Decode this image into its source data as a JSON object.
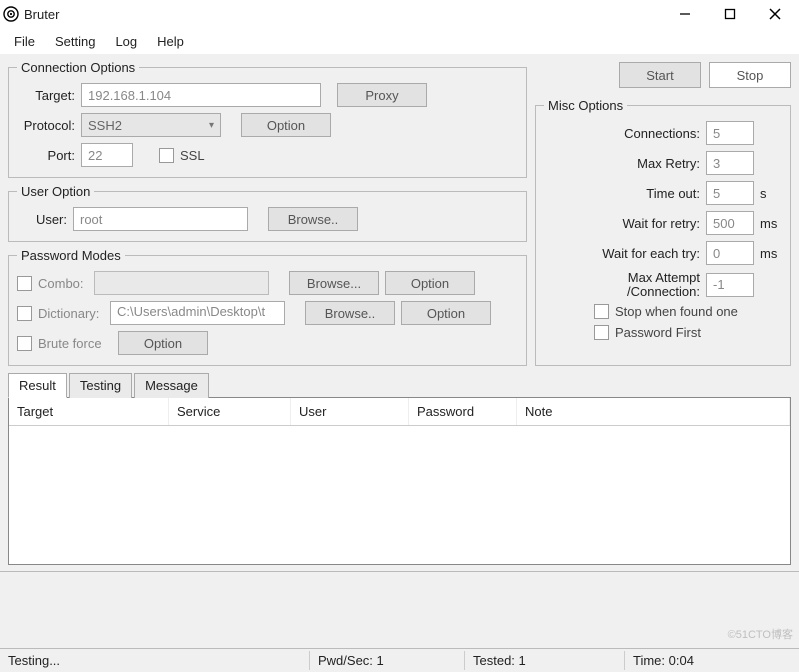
{
  "window": {
    "title": "Bruter"
  },
  "menu": {
    "file": "File",
    "setting": "Setting",
    "log": "Log",
    "help": "Help"
  },
  "connection": {
    "legend": "Connection Options",
    "target_label": "Target:",
    "target_value": "192.168.1.104",
    "proxy_btn": "Proxy",
    "protocol_label": "Protocol:",
    "protocol_value": "SSH2",
    "protocol_option_btn": "Option",
    "port_label": "Port:",
    "port_value": "22",
    "ssl_label": "SSL"
  },
  "user": {
    "legend": "User Option",
    "label": "User:",
    "value": "root",
    "browse_btn": "Browse.."
  },
  "password": {
    "legend": "Password Modes",
    "combo_label": "Combo:",
    "combo_browse": "Browse...",
    "combo_option": "Option",
    "dict_label": "Dictionary:",
    "dict_path": "C:\\Users\\admin\\Desktop\\t",
    "dict_browse": "Browse..",
    "dict_option": "Option",
    "brute_label": "Brute force",
    "brute_option": "Option"
  },
  "actions": {
    "start": "Start",
    "stop": "Stop"
  },
  "misc": {
    "legend": "Misc Options",
    "connections_label": "Connections:",
    "connections_value": "5",
    "maxretry_label": "Max Retry:",
    "maxretry_value": "3",
    "timeout_label": "Time out:",
    "timeout_value": "5",
    "timeout_unit": "s",
    "waitretry_label": "Wait for retry:",
    "waitretry_value": "500",
    "waitretry_unit": "ms",
    "waiteach_label": "Wait for each try:",
    "waiteach_value": "0",
    "waiteach_unit": "ms",
    "max_attempt_label": "Max Attempt\n/Connection:",
    "max_attempt_value": "-1",
    "stop_found_label": "Stop when found one",
    "password_first_label": "Password First"
  },
  "tabs": {
    "result": "Result",
    "testing": "Testing",
    "message": "Message"
  },
  "columns": {
    "target": "Target",
    "service": "Service",
    "user": "User",
    "password": "Password",
    "note": "Note"
  },
  "status": {
    "state": "Testing...",
    "pwd_sec": "Pwd/Sec: 1",
    "tested": "Tested: 1",
    "time": "Time: 0:04"
  },
  "watermark": "©51CTO博客"
}
